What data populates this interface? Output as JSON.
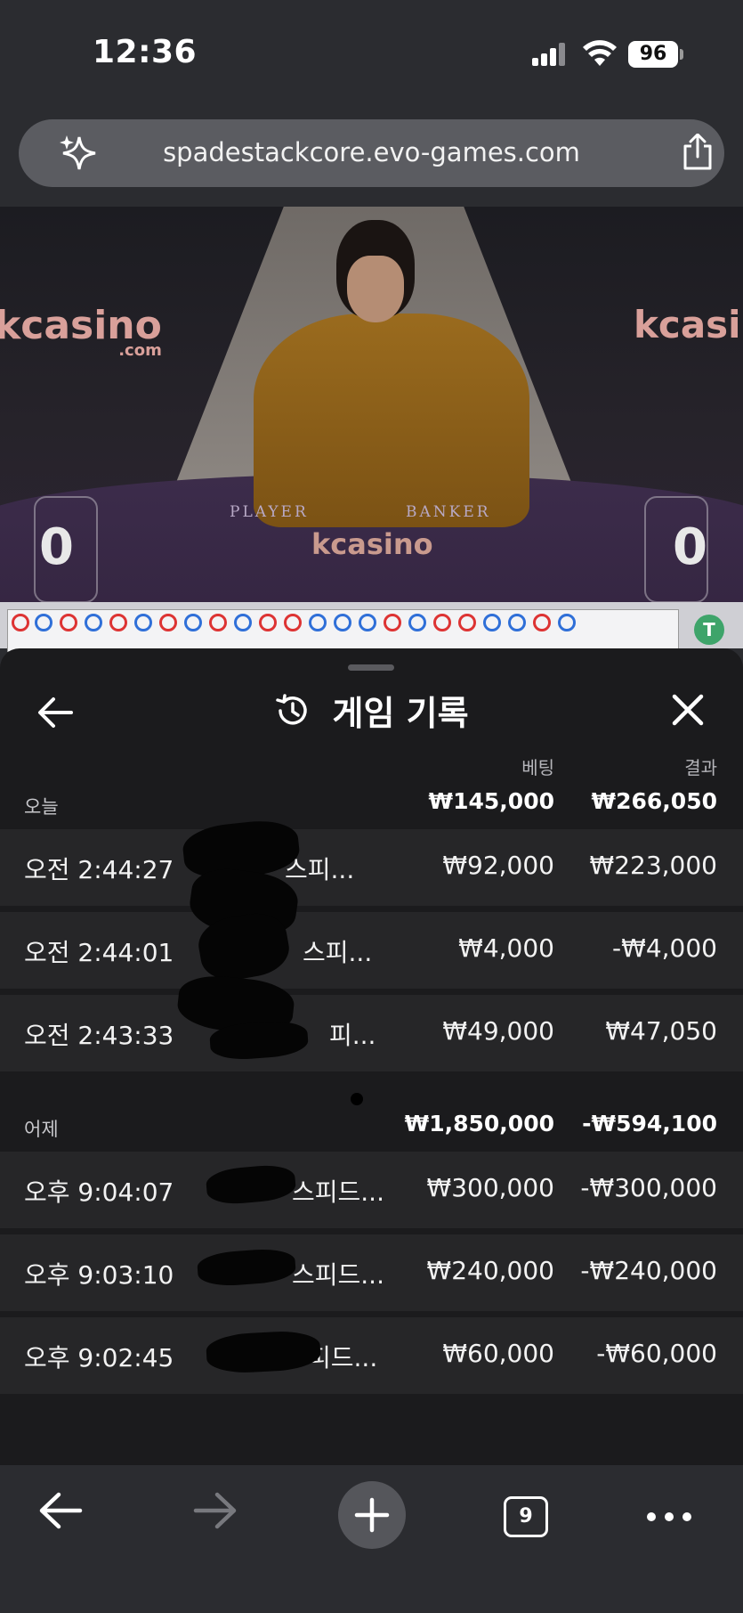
{
  "status_bar": {
    "time": "12:36",
    "battery": "96"
  },
  "browser": {
    "url": "spadestackcore.evo-games.com",
    "tab_count": "9"
  },
  "video": {
    "brand": "kcasino",
    "brand_sub": ".com",
    "player_label": "PLAYER",
    "banker_label": "BANKER",
    "player_score": "0",
    "banker_score": "0"
  },
  "roadmap": {
    "tie_label": "T"
  },
  "sheet": {
    "title": "게임 기록",
    "col_bet": "베팅",
    "col_result": "결과",
    "groups": [
      {
        "label": "오늘",
        "bet_total": "₩145,000",
        "result_total": "₩266,050",
        "rows": [
          {
            "time": "오전 2:44:27",
            "game": "스피...",
            "bet": "₩92,000",
            "result": "₩223,000"
          },
          {
            "time": "오전 2:44:01",
            "game": "스피...",
            "bet": "₩4,000",
            "result": "-₩4,000"
          },
          {
            "time": "오전 2:43:33",
            "game": "피...",
            "bet": "₩49,000",
            "result": "₩47,050"
          }
        ]
      },
      {
        "label": "어제",
        "bet_total": "₩1,850,000",
        "result_total": "-₩594,100",
        "rows": [
          {
            "time": "오후 9:04:07",
            "game": "스피드...",
            "bet": "₩300,000",
            "result": "-₩300,000"
          },
          {
            "time": "오후 9:03:10",
            "game": "스피드...",
            "bet": "₩240,000",
            "result": "-₩240,000"
          },
          {
            "time": "오후 9:02:45",
            "game": "피드...",
            "bet": "₩60,000",
            "result": "-₩60,000"
          }
        ]
      }
    ]
  },
  "icons": {
    "sparkle": "sparkle-icon",
    "share": "share-icon",
    "back": "arrow-left-icon",
    "history": "history-icon",
    "close": "close-icon",
    "forward": "arrow-right-icon",
    "plus": "plus-icon",
    "tabs": "tabs-icon",
    "more": "more-icon"
  }
}
